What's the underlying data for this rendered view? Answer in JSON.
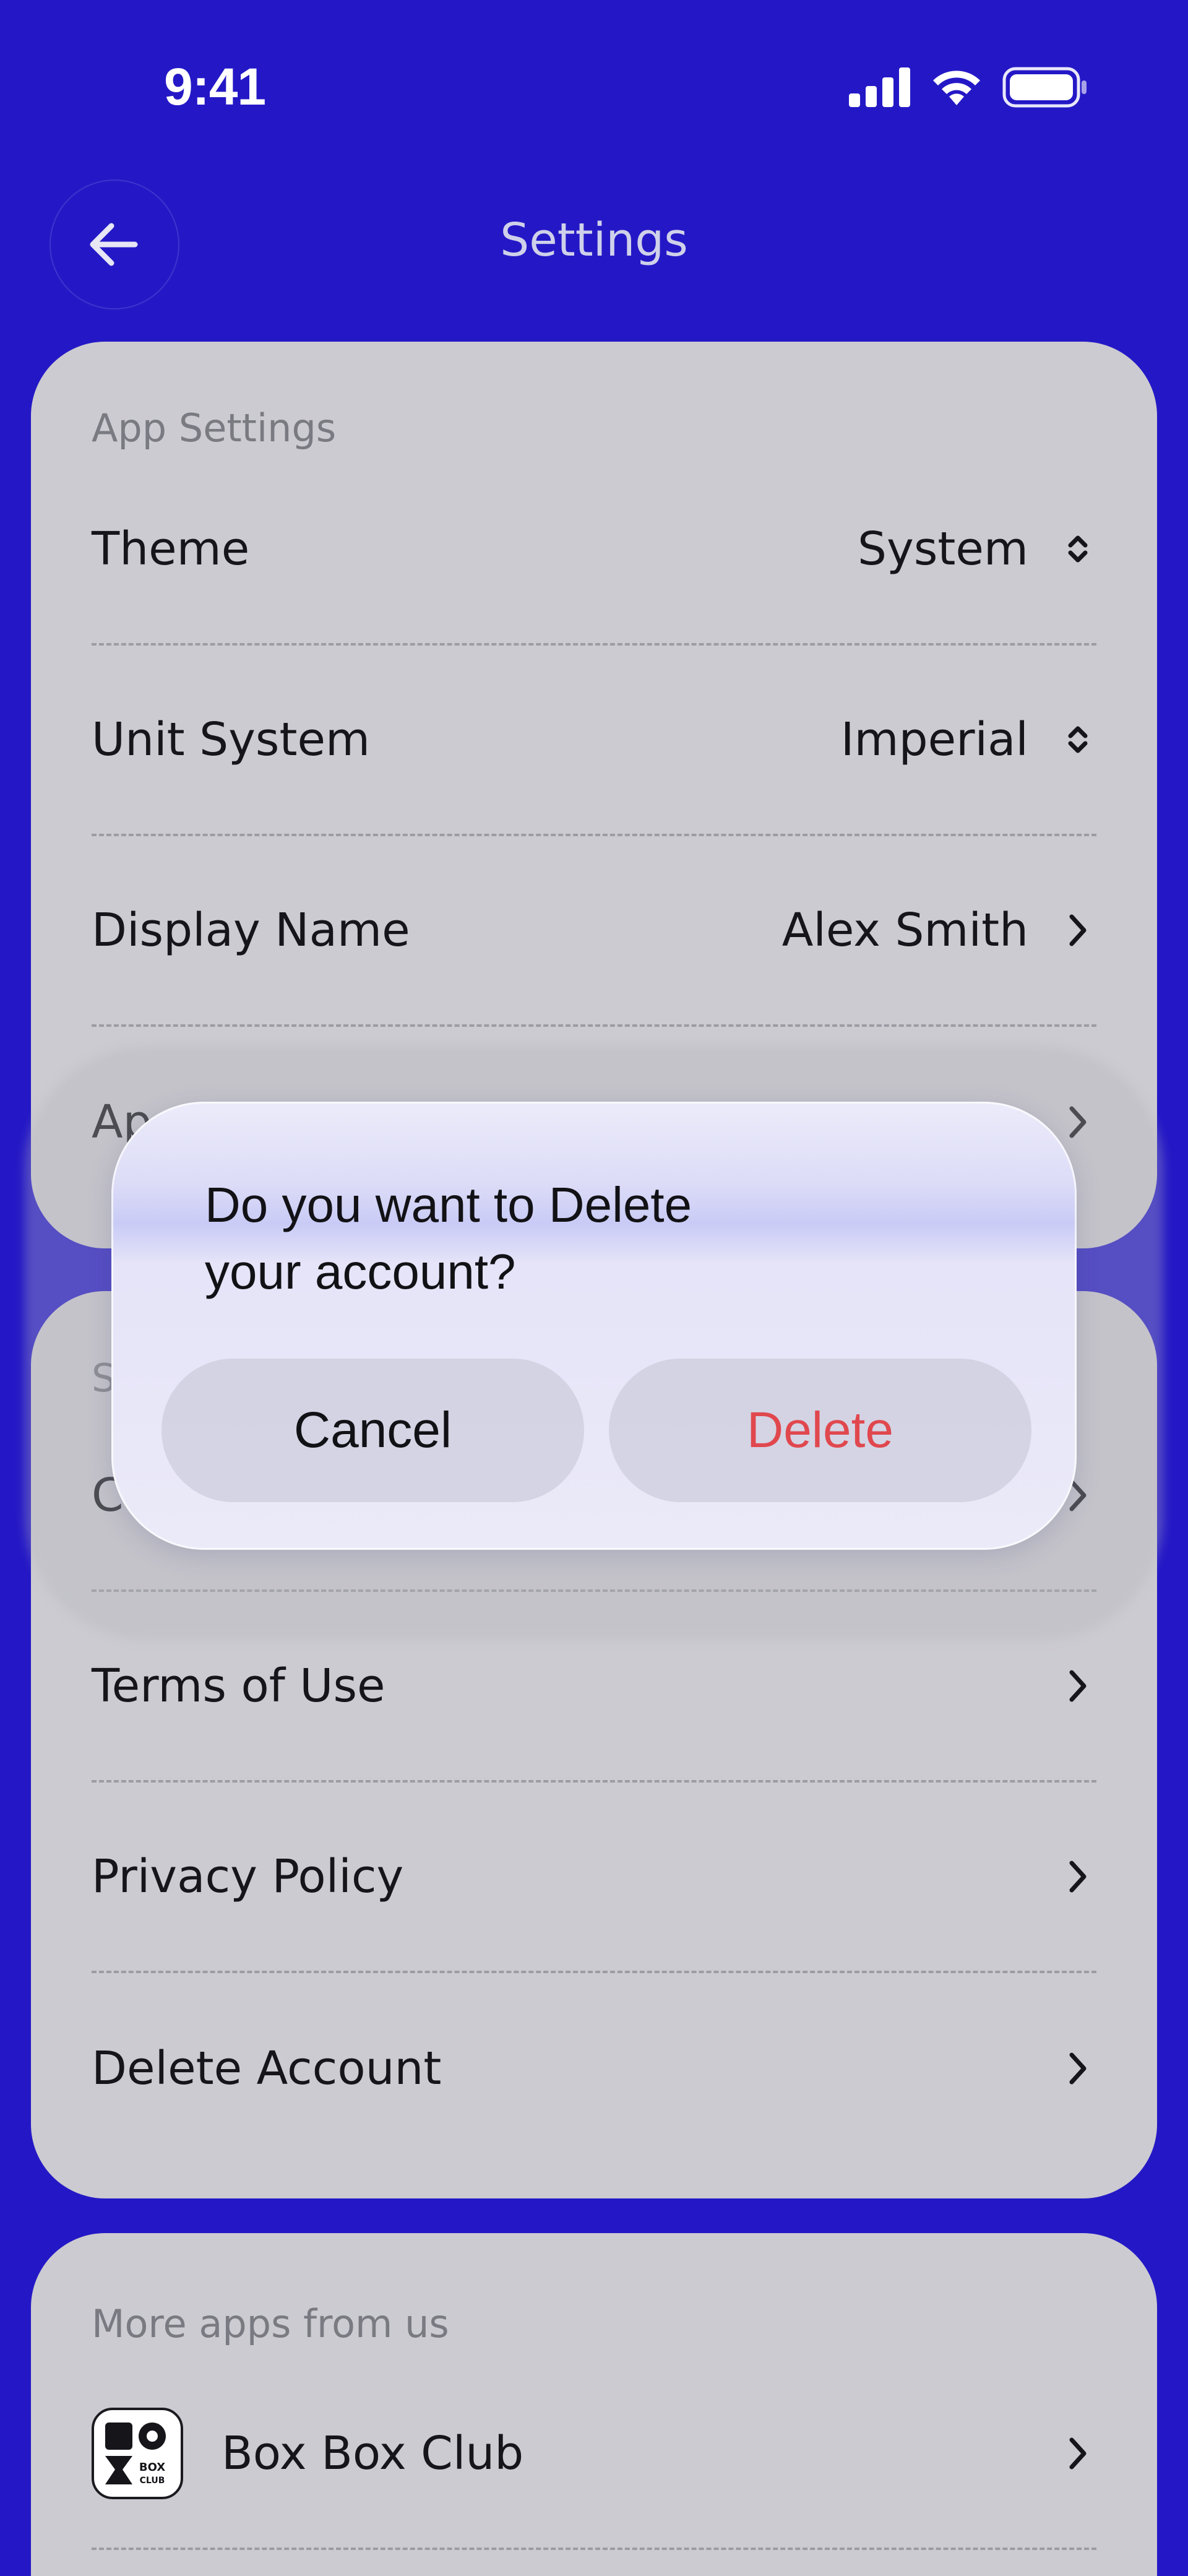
{
  "status_bar": {
    "time": "9:41"
  },
  "header": {
    "title": "Settings"
  },
  "app_settings": {
    "section_label": "App Settings",
    "rows": [
      {
        "label": "Theme",
        "value": "System"
      },
      {
        "label": "Unit System",
        "value": "Imperial"
      },
      {
        "label": "Display Name",
        "value": "Alex Smith"
      },
      {
        "label": "Ap"
      }
    ]
  },
  "support": {
    "section_label": "S",
    "rows": [
      {
        "label": "Co"
      },
      {
        "label": "Terms of Use"
      },
      {
        "label": "Privacy Policy"
      },
      {
        "label": "Delete Account"
      }
    ]
  },
  "more_apps": {
    "section_label": "More apps from us",
    "apps": [
      {
        "name": "Box Box Club",
        "logo_text": "BOX CLUB"
      }
    ]
  },
  "dialog": {
    "message_line1": "Do you want to Delete",
    "message_line2": "your account?",
    "cancel_label": "Cancel",
    "delete_label": "Delete"
  },
  "colors": {
    "background": "#2418C6",
    "card": "#cccbd1",
    "destructive": "#e0484e"
  }
}
